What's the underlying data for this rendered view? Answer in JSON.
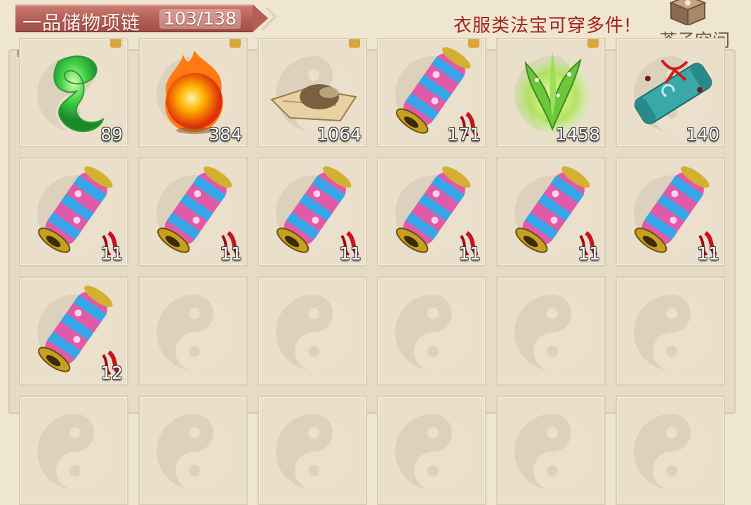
{
  "header": {
    "title": "一品储物项链",
    "capacity": "103/138",
    "hint": "衣服类法宝可穿多件!",
    "space_button_label": "芥子空间"
  },
  "colors": {
    "ribbon": "#b45e56",
    "hint_text": "#a3221e",
    "panel_bg": "#e6dcc5"
  },
  "inventory": {
    "rows": [
      [
        {
          "item": "green-jade-icon",
          "count": "89",
          "locked": true
        },
        {
          "item": "fire-orb-icon",
          "count": "384",
          "locked": true
        },
        {
          "item": "old-map-icon",
          "count": "1064",
          "locked": true
        },
        {
          "item": "pink-scroll-icon",
          "count": "171",
          "locked": true
        },
        {
          "item": "spirit-herb-icon",
          "count": "1458",
          "locked": true
        },
        {
          "item": "blue-scroll-icon",
          "count": "140",
          "locked": false
        }
      ],
      [
        {
          "item": "pink-scroll-icon",
          "count": "11"
        },
        {
          "item": "pink-scroll-icon",
          "count": "11"
        },
        {
          "item": "pink-scroll-icon",
          "count": "11"
        },
        {
          "item": "pink-scroll-icon",
          "count": "11"
        },
        {
          "item": "pink-scroll-icon",
          "count": "11"
        },
        {
          "item": "pink-scroll-icon",
          "count": "11"
        }
      ],
      [
        {
          "item": "pink-scroll-icon",
          "count": "12"
        },
        {
          "item": "empty-slot",
          "count": ""
        },
        {
          "item": "empty-slot",
          "count": ""
        },
        {
          "item": "empty-slot",
          "count": ""
        },
        {
          "item": "empty-slot",
          "count": ""
        },
        {
          "item": "empty-slot",
          "count": ""
        }
      ],
      [
        {
          "item": "empty-slot",
          "count": ""
        },
        {
          "item": "empty-slot",
          "count": ""
        },
        {
          "item": "empty-slot",
          "count": ""
        },
        {
          "item": "empty-slot",
          "count": ""
        },
        {
          "item": "empty-slot",
          "count": ""
        },
        {
          "item": "empty-slot",
          "count": ""
        }
      ]
    ]
  }
}
